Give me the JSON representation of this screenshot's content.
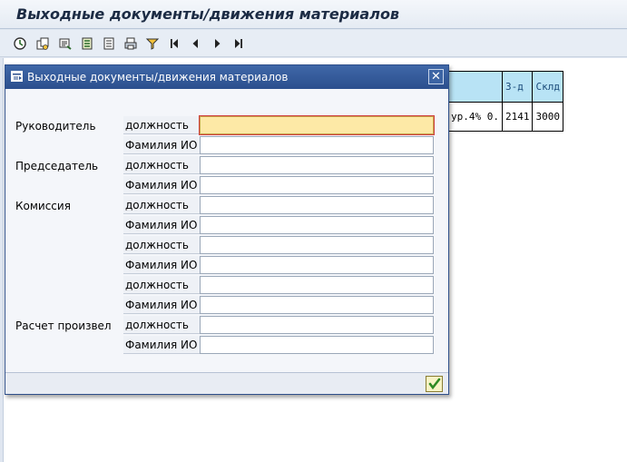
{
  "window": {
    "title": "Выходные документы/движения материалов"
  },
  "toolbar": {
    "buttons": [
      "execute-icon",
      "copy-documents-icon",
      "select-layout-icon",
      "details-icon",
      "details-list-icon",
      "print-icon",
      "filter-icon",
      "first-page-icon",
      "previous-page-icon",
      "next-page-icon",
      "last-page-icon"
    ]
  },
  "background_table": {
    "header": [
      "",
      "З-д",
      "Склд"
    ],
    "row": [
      "ур.4% 0.",
      "2141",
      "3000"
    ]
  },
  "dialog": {
    "title": "Выходные документы/движения материалов",
    "close_label": "✕",
    "groups": [
      {
        "label": "Руководитель",
        "fields": [
          {
            "label": "должность",
            "value": ""
          },
          {
            "label": "Фамилия ИО",
            "value": ""
          }
        ]
      },
      {
        "label": "Председатель",
        "fields": [
          {
            "label": "должность",
            "value": ""
          },
          {
            "label": "Фамилия ИО",
            "value": ""
          }
        ]
      },
      {
        "label": "Комиссия",
        "fields": [
          {
            "label": "должность",
            "value": ""
          },
          {
            "label": "Фамилия ИО",
            "value": ""
          },
          {
            "label": "должность",
            "value": ""
          },
          {
            "label": "Фамилия ИО",
            "value": ""
          },
          {
            "label": "должность",
            "value": ""
          },
          {
            "label": "Фамилия ИО",
            "value": ""
          }
        ]
      },
      {
        "label": "Расчет произвел",
        "fields": [
          {
            "label": "должность",
            "value": ""
          },
          {
            "label": "Фамилия ИО",
            "value": ""
          }
        ]
      }
    ],
    "confirm_icon": "checkmark-icon"
  },
  "colors": {
    "accent": "#2b4f8e",
    "active_input": "#fde9a6",
    "table_header": "#b8e3f5"
  }
}
